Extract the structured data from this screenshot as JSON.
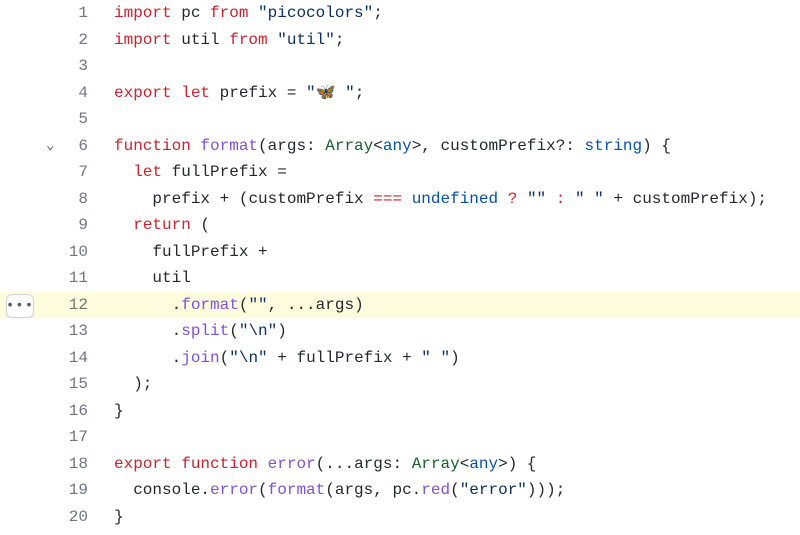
{
  "more_button_label": "•••",
  "highlighted_line": 12,
  "folded_line": 6,
  "lines": [
    {
      "n": 1,
      "tokens": [
        [
          "kw",
          "import"
        ],
        [
          "id",
          " pc "
        ],
        [
          "kw",
          "from"
        ],
        [
          "id",
          " "
        ],
        [
          "str",
          "\"picocolors\""
        ],
        [
          "id",
          ";"
        ]
      ]
    },
    {
      "n": 2,
      "tokens": [
        [
          "kw",
          "import"
        ],
        [
          "id",
          " util "
        ],
        [
          "kw",
          "from"
        ],
        [
          "id",
          " "
        ],
        [
          "str",
          "\"util\""
        ],
        [
          "id",
          ";"
        ]
      ]
    },
    {
      "n": 3,
      "tokens": []
    },
    {
      "n": 4,
      "tokens": [
        [
          "kw",
          "export"
        ],
        [
          "id",
          " "
        ],
        [
          "kw",
          "let"
        ],
        [
          "id",
          " prefix "
        ],
        [
          "id",
          "= "
        ],
        [
          "str",
          "\"🦋 \""
        ],
        [
          "id",
          ";"
        ]
      ]
    },
    {
      "n": 5,
      "tokens": []
    },
    {
      "n": 6,
      "tokens": [
        [
          "kw",
          "function"
        ],
        [
          "id",
          " "
        ],
        [
          "fn",
          "format"
        ],
        [
          "id",
          "(args: "
        ],
        [
          "type",
          "Array"
        ],
        [
          "id",
          "<"
        ],
        [
          "kw2",
          "any"
        ],
        [
          "id",
          ">, customPrefix?: "
        ],
        [
          "kw2",
          "string"
        ],
        [
          "id",
          ") {"
        ]
      ]
    },
    {
      "n": 7,
      "tokens": [
        [
          "id",
          "  "
        ],
        [
          "kw",
          "let"
        ],
        [
          "id",
          " fullPrefix "
        ],
        [
          "id",
          "="
        ]
      ]
    },
    {
      "n": 8,
      "tokens": [
        [
          "id",
          "    prefix "
        ],
        [
          "id",
          "+"
        ],
        [
          "id",
          " (customPrefix "
        ],
        [
          "op",
          "==="
        ],
        [
          "id",
          " "
        ],
        [
          "kw2",
          "undefined"
        ],
        [
          "id",
          " "
        ],
        [
          "op",
          "?"
        ],
        [
          "id",
          " "
        ],
        [
          "str",
          "\"\""
        ],
        [
          "id",
          " "
        ],
        [
          "op",
          ":"
        ],
        [
          "id",
          " "
        ],
        [
          "str",
          "\" \""
        ],
        [
          "id",
          " "
        ],
        [
          "id",
          "+"
        ],
        [
          "id",
          " customPrefix);"
        ]
      ]
    },
    {
      "n": 9,
      "tokens": [
        [
          "id",
          "  "
        ],
        [
          "kw",
          "return"
        ],
        [
          "id",
          " ("
        ]
      ]
    },
    {
      "n": 10,
      "tokens": [
        [
          "id",
          "    fullPrefix "
        ],
        [
          "id",
          "+"
        ]
      ]
    },
    {
      "n": 11,
      "tokens": [
        [
          "id",
          "    util"
        ]
      ]
    },
    {
      "n": 12,
      "tokens": [
        [
          "id",
          "      ."
        ],
        [
          "fn",
          "format"
        ],
        [
          "id",
          "("
        ],
        [
          "str",
          "\"\""
        ],
        [
          "id",
          ", "
        ],
        [
          "id",
          "..."
        ],
        [
          "id",
          "args)"
        ]
      ]
    },
    {
      "n": 13,
      "tokens": [
        [
          "id",
          "      ."
        ],
        [
          "fn",
          "split"
        ],
        [
          "id",
          "("
        ],
        [
          "str",
          "\"\\n\""
        ],
        [
          "id",
          ")"
        ]
      ]
    },
    {
      "n": 14,
      "tokens": [
        [
          "id",
          "      ."
        ],
        [
          "fn",
          "join"
        ],
        [
          "id",
          "("
        ],
        [
          "str",
          "\"\\n\""
        ],
        [
          "id",
          " "
        ],
        [
          "id",
          "+"
        ],
        [
          "id",
          " fullPrefix "
        ],
        [
          "id",
          "+"
        ],
        [
          "id",
          " "
        ],
        [
          "str",
          "\" \""
        ],
        [
          "id",
          ")"
        ]
      ]
    },
    {
      "n": 15,
      "tokens": [
        [
          "id",
          "  );"
        ]
      ]
    },
    {
      "n": 16,
      "tokens": [
        [
          "id",
          "}"
        ]
      ]
    },
    {
      "n": 17,
      "tokens": []
    },
    {
      "n": 18,
      "tokens": [
        [
          "kw",
          "export"
        ],
        [
          "id",
          " "
        ],
        [
          "kw",
          "function"
        ],
        [
          "id",
          " "
        ],
        [
          "fn",
          "error"
        ],
        [
          "id",
          "("
        ],
        [
          "id",
          "..."
        ],
        [
          "id",
          "args: "
        ],
        [
          "type",
          "Array"
        ],
        [
          "id",
          "<"
        ],
        [
          "kw2",
          "any"
        ],
        [
          "id",
          ">) {"
        ]
      ]
    },
    {
      "n": 19,
      "tokens": [
        [
          "id",
          "  console."
        ],
        [
          "fn",
          "error"
        ],
        [
          "id",
          "("
        ],
        [
          "fn",
          "format"
        ],
        [
          "id",
          "(args, pc."
        ],
        [
          "fn",
          "red"
        ],
        [
          "id",
          "("
        ],
        [
          "str",
          "\"error\""
        ],
        [
          "id",
          ")));"
        ]
      ]
    },
    {
      "n": 20,
      "tokens": [
        [
          "id",
          "}"
        ]
      ]
    }
  ]
}
